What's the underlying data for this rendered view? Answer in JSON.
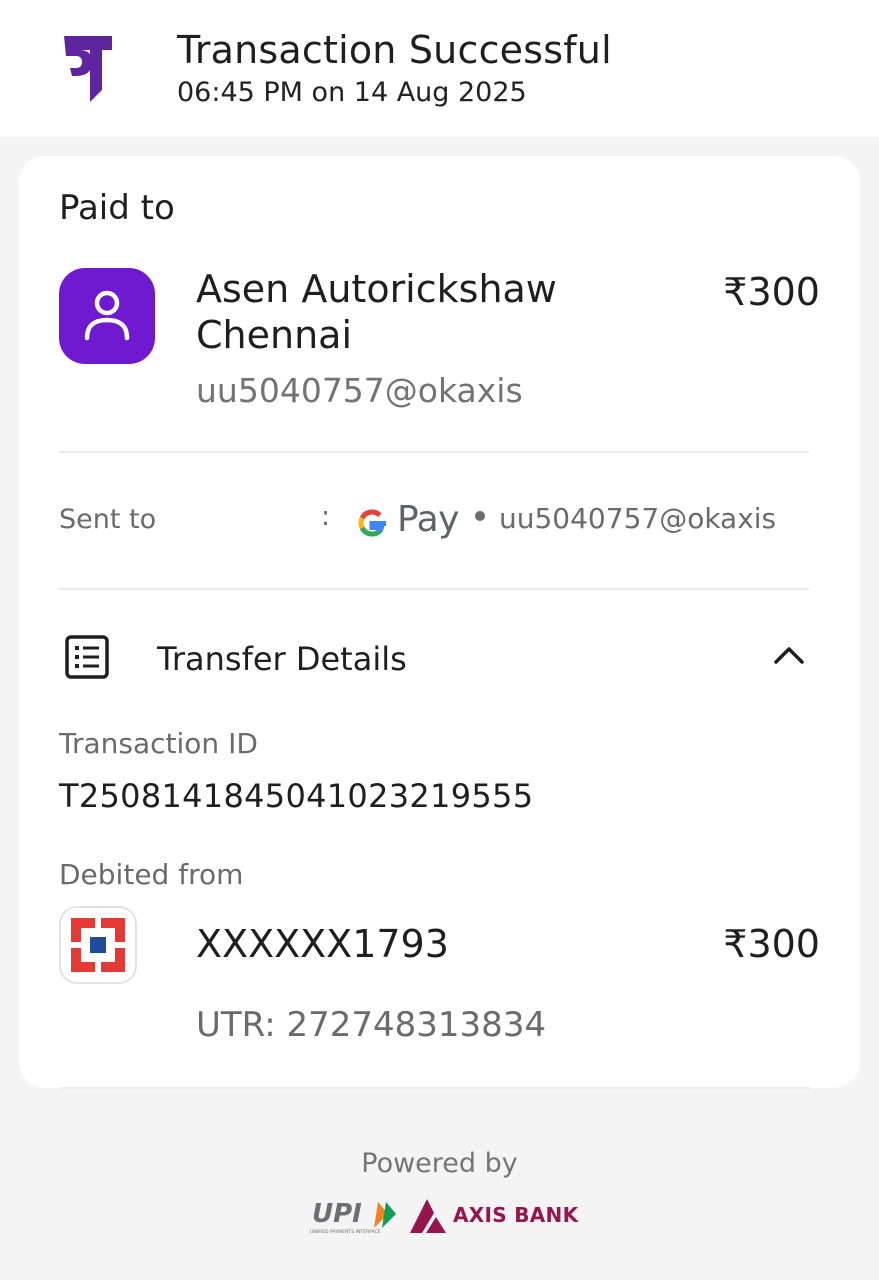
{
  "header": {
    "title": "Transaction Successful",
    "subtitle": "06:45 PM on 14 Aug 2025",
    "logo_icon": "phonepe-logo-icon",
    "logo_color": "#5f259f"
  },
  "payee": {
    "section_label": "Paid to",
    "name": "Asen Autorickshaw Chennai",
    "amount": "₹300",
    "upi_id": "uu5040757@okaxis",
    "avatar_icon": "user-icon",
    "avatar_color": "#6f1ad1"
  },
  "sent_to": {
    "label": "Sent to",
    "separator": ":",
    "app_name": "Pay",
    "app_icon": "google-pay-icon",
    "upi_id": "uu5040757@okaxis"
  },
  "transfer_details": {
    "label": "Transfer Details",
    "icon": "receipt-list-icon",
    "toggle_icon": "chevron-up-icon",
    "transaction_id_label": "Transaction ID",
    "transaction_id": "T2508141845041023219555",
    "debited_from_label": "Debited from",
    "bank_icon": "hdfc-bank-icon",
    "account": "XXXXXX1793",
    "amount": "₹300",
    "utr": "UTR: 272748313834"
  },
  "footer": {
    "powered_by": "Powered by",
    "upi_logo_text": "UPI",
    "upi_tagline": "UNIFIED PAYMENTS INTERFACE",
    "bank_name": "AXIS BANK",
    "bank_color": "#97144d"
  }
}
